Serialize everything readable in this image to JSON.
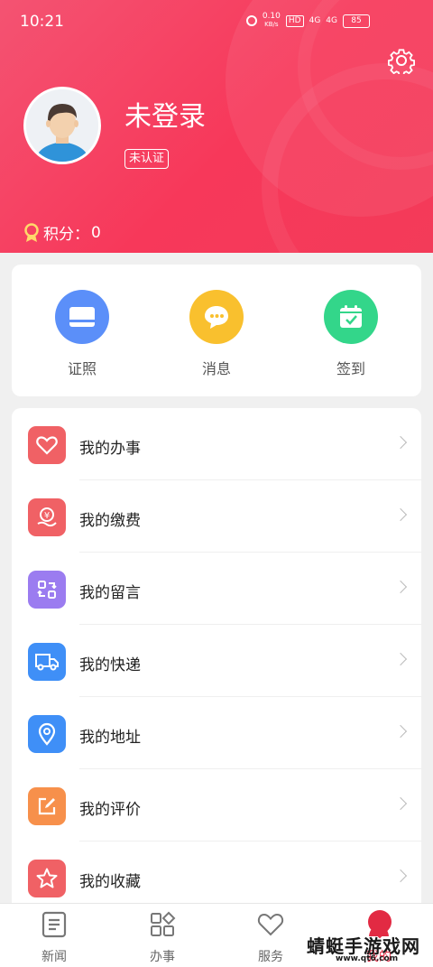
{
  "status_bar": {
    "time": "10:21",
    "net_speed": "0.10",
    "net_unit": "KB/s",
    "hd": "HD",
    "sim1": "4G",
    "sim2": "4G",
    "battery": "85"
  },
  "profile": {
    "username": "未登录",
    "cert_badge": "未认证",
    "points_label": "积分：",
    "points_value": "0"
  },
  "quick_actions": [
    {
      "label": "证照",
      "icon": "id-card-icon",
      "color": "#5b8ff9"
    },
    {
      "label": "消息",
      "icon": "chat-bubble-icon",
      "color": "#f9c02e"
    },
    {
      "label": "签到",
      "icon": "calendar-check-icon",
      "color": "#33d68a"
    }
  ],
  "menu": [
    {
      "label": "我的办事",
      "icon": "heart-icon",
      "color": "#f06165"
    },
    {
      "label": "我的缴费",
      "icon": "yen-hand-icon",
      "color": "#f06165"
    },
    {
      "label": "我的留言",
      "icon": "message-swap-icon",
      "color": "#9b7cf0"
    },
    {
      "label": "我的快递",
      "icon": "truck-icon",
      "color": "#3f8ff7"
    },
    {
      "label": "我的地址",
      "icon": "location-pin-icon",
      "color": "#3f8ff7"
    },
    {
      "label": "我的评价",
      "icon": "edit-icon",
      "color": "#f7904b"
    },
    {
      "label": "我的收藏",
      "icon": "star-icon",
      "color": "#f06165"
    }
  ],
  "tabs": [
    {
      "label": "新闻",
      "icon": "news-icon"
    },
    {
      "label": "办事",
      "icon": "grid-icon"
    },
    {
      "label": "服务",
      "icon": "heart-outline-icon"
    },
    {
      "label": "我的",
      "icon": "person-icon"
    }
  ],
  "watermark": {
    "text": "蜻蜓手游戏网",
    "url": "www.qt6.com"
  },
  "colors": {
    "header": "#f7385a",
    "accent": "#e22a43"
  }
}
